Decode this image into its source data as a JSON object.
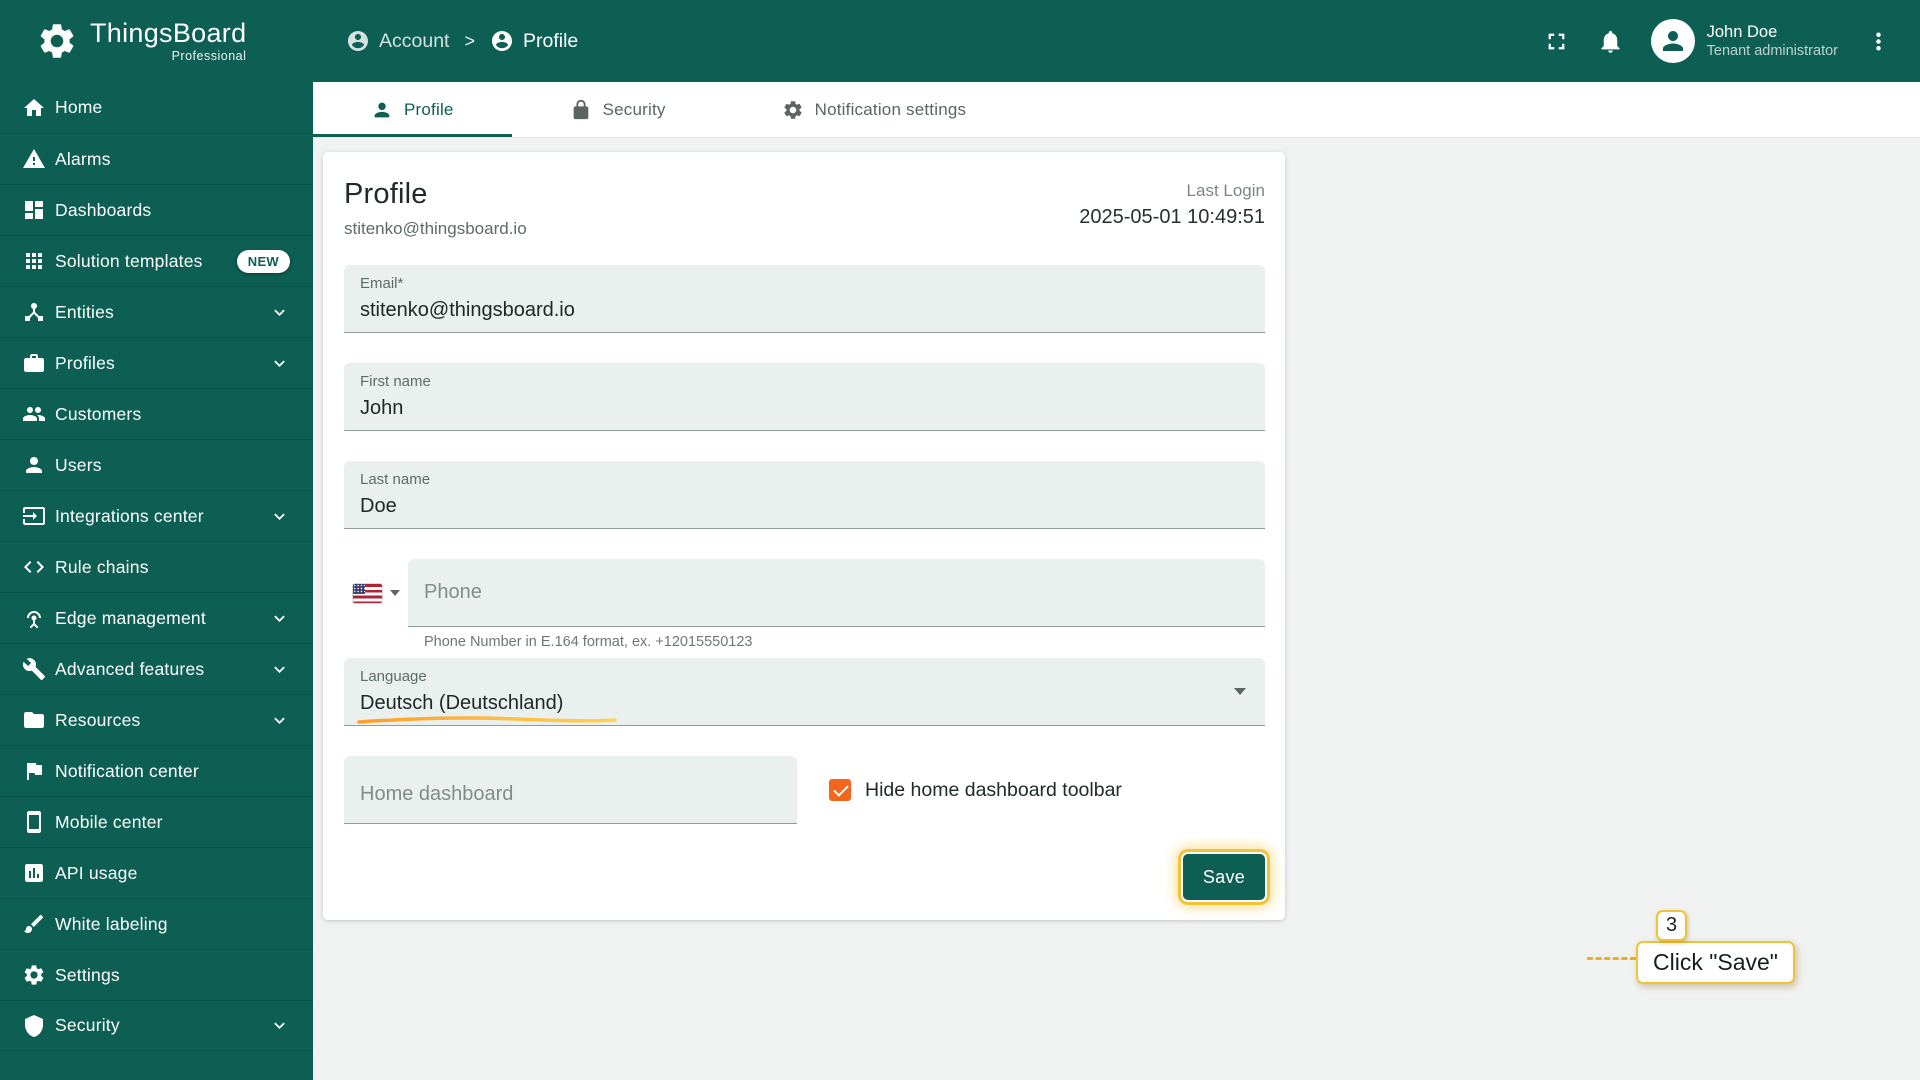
{
  "colors": {
    "primary": "#0d5e53",
    "checkbox_accent": "#f4661c",
    "annotation_yellow": "#f2c237",
    "field_background": "#e9f0ee"
  },
  "header": {
    "logo_title": "ThingsBoard",
    "logo_subtitle": "Professional",
    "breadcrumb": [
      {
        "label": "Account",
        "icon": "account-circle-icon"
      },
      {
        "label": "Profile",
        "icon": "account-circle-icon"
      }
    ],
    "user": {
      "name": "John Doe",
      "role": "Tenant administrator"
    }
  },
  "sidebar": {
    "items": [
      {
        "label": "Home",
        "icon": "home-icon"
      },
      {
        "label": "Alarms",
        "icon": "warning-icon"
      },
      {
        "label": "Dashboards",
        "icon": "dashboard-icon"
      },
      {
        "label": "Solution templates",
        "icon": "apps-grid-icon",
        "badge": "NEW"
      },
      {
        "label": "Entities",
        "icon": "device-hub-icon",
        "expandable": true
      },
      {
        "label": "Profiles",
        "icon": "badge-icon",
        "expandable": true
      },
      {
        "label": "Customers",
        "icon": "people-icon"
      },
      {
        "label": "Users",
        "icon": "person-icon"
      },
      {
        "label": "Integrations center",
        "icon": "integration-icon",
        "expandable": true
      },
      {
        "label": "Rule chains",
        "icon": "code-icon"
      },
      {
        "label": "Edge management",
        "icon": "antenna-icon",
        "expandable": true
      },
      {
        "label": "Advanced features",
        "icon": "wrench-icon",
        "expandable": true
      },
      {
        "label": "Resources",
        "icon": "folder-icon",
        "expandable": true
      },
      {
        "label": "Notification center",
        "icon": "flag-icon"
      },
      {
        "label": "Mobile center",
        "icon": "smartphone-icon"
      },
      {
        "label": "API usage",
        "icon": "bar-chart-icon"
      },
      {
        "label": "White labeling",
        "icon": "paint-brush-icon"
      },
      {
        "label": "Settings",
        "icon": "gear-icon"
      },
      {
        "label": "Security",
        "icon": "shield-icon",
        "expandable": true
      }
    ]
  },
  "tabs": [
    {
      "label": "Profile",
      "icon": "person-icon",
      "active": true
    },
    {
      "label": "Security",
      "icon": "lock-icon",
      "active": false
    },
    {
      "label": "Notification settings",
      "icon": "gear-icon",
      "active": false
    }
  ],
  "profile": {
    "title": "Profile",
    "subtitle": "stitenko@thingsboard.io",
    "last_login_label": "Last Login",
    "last_login_value": "2025-05-01 10:49:51",
    "fields": {
      "email": {
        "label": "Email*",
        "value": "stitenko@thingsboard.io"
      },
      "first_name": {
        "label": "First name",
        "value": "John"
      },
      "last_name": {
        "label": "Last name",
        "value": "Doe"
      },
      "phone": {
        "placeholder": "Phone",
        "helper": "Phone Number in E.164 format, ex. +12015550123",
        "country_flag": "us-flag-icon"
      },
      "language": {
        "label": "Language",
        "value": "Deutsch (Deutschland)"
      },
      "home_dashboard": {
        "placeholder": "Home dashboard"
      },
      "hide_toolbar": {
        "label": "Hide home dashboard toolbar",
        "checked": true
      }
    },
    "save_label": "Save"
  },
  "annotation": {
    "step": "3",
    "label": "Click \"Save\""
  }
}
